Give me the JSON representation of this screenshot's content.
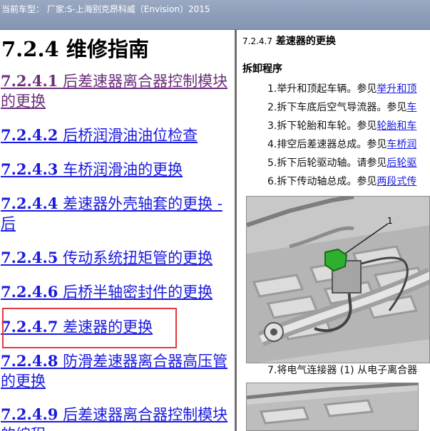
{
  "titlebar": {
    "text": "当前车型： 厂家:S-上海别克昂科威（Envision）2015"
  },
  "section": {
    "number": "7.2.4",
    "title": "维修指南"
  },
  "toc": [
    {
      "num": "7.2.4.1",
      "title": "后差速器离合器控制模块的更换"
    },
    {
      "num": "7.2.4.2",
      "title": "后桥润滑油油位检查"
    },
    {
      "num": "7.2.4.3",
      "title": "车桥润滑油的更换"
    },
    {
      "num": "7.2.4.4",
      "title": "差速器外壳轴套的更换 - 后"
    },
    {
      "num": "7.2.4.5",
      "title": "传动系统扭矩管的更换"
    },
    {
      "num": "7.2.4.6",
      "title": "后桥半轴密封件的更换"
    },
    {
      "num": "7.2.4.7",
      "title": "差速器的更换"
    },
    {
      "num": "7.2.4.8",
      "title": "防滑差速器离合器高压管的更换"
    },
    {
      "num": "7.2.4.9",
      "title": "后差速器离合器控制模块的编程"
    }
  ],
  "detail": {
    "heading_num": "7.2.4.7",
    "heading_title": "差速器的更换",
    "subheading": "拆卸程序",
    "steps": [
      {
        "text": "1.举升和顶起车辆。参见",
        "ref": "举升和顶"
      },
      {
        "text": "2.拆下车底后空气导流器。参见",
        "ref": "车"
      },
      {
        "text": "3.拆下轮胎和车轮。参见",
        "ref": "轮胎和车"
      },
      {
        "text": "4.排空后差速器总成。参见",
        "ref": "车桥润"
      },
      {
        "text": "5.拆下后轮驱动轴。请参见",
        "ref": "后轮驱"
      },
      {
        "text": "6.拆下传动轴总成。参见",
        "ref": "两段式传"
      }
    ],
    "figure_callout": "1",
    "caption": "7.将电气连接器 (1) 从电子离合器"
  }
}
